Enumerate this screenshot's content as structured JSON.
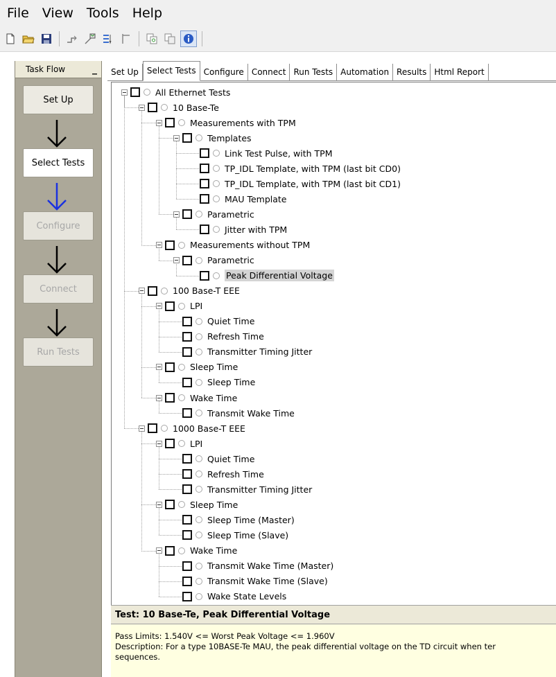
{
  "menu": [
    "File",
    "View",
    "Tools",
    "Help"
  ],
  "toolbar_icons": [
    "new-file-icon",
    "open-folder-icon",
    "save-icon",
    "step-icon",
    "export-icon",
    "filter-icon",
    "align-icon",
    "copy-icon",
    "paste-icon",
    "info-icon"
  ],
  "taskflow": {
    "header": "Task Flow",
    "minimize": "_",
    "steps": [
      {
        "label": "Set Up",
        "state": "done"
      },
      {
        "label": "Select Tests",
        "state": "active"
      },
      {
        "label": "Configure",
        "state": "disabled"
      },
      {
        "label": "Connect",
        "state": "disabled"
      },
      {
        "label": "Run Tests",
        "state": "disabled"
      }
    ],
    "arrow_colors": [
      "#000000",
      "#1a32e0",
      "#000000",
      "#000000"
    ]
  },
  "tabs": [
    "Set Up",
    "Select Tests",
    "Configure",
    "Connect",
    "Run Tests",
    "Automation",
    "Results",
    "Html Report"
  ],
  "selected_tab": "Select Tests",
  "tree": [
    {
      "label": "All Ethernet Tests",
      "level": 0,
      "exp": true
    },
    {
      "label": "10 Base-Te",
      "level": 1,
      "exp": true
    },
    {
      "label": "Measurements with TPM",
      "level": 2,
      "exp": true
    },
    {
      "label": "Templates",
      "level": 3,
      "exp": true
    },
    {
      "label": "Link Test Pulse, with TPM",
      "level": 4,
      "exp": false
    },
    {
      "label": "TP_IDL Template, with TPM (last bit CD0)",
      "level": 4,
      "exp": false
    },
    {
      "label": "TP_IDL Template, with TPM (last bit CD1)",
      "level": 4,
      "exp": false
    },
    {
      "label": "MAU Template",
      "level": 4,
      "exp": false
    },
    {
      "label": "Parametric",
      "level": 3,
      "exp": true
    },
    {
      "label": "Jitter with TPM",
      "level": 4,
      "exp": false
    },
    {
      "label": "Measurements without TPM",
      "level": 2,
      "exp": true
    },
    {
      "label": "Parametric",
      "level": 3,
      "exp": true
    },
    {
      "label": "Peak Differential Voltage",
      "level": 4,
      "exp": false,
      "selected": true
    },
    {
      "label": "100 Base-T EEE",
      "level": 1,
      "exp": true
    },
    {
      "label": "LPI",
      "level": 2,
      "exp": true
    },
    {
      "label": "Quiet Time",
      "level": 3,
      "exp": false
    },
    {
      "label": "Refresh Time",
      "level": 3,
      "exp": false
    },
    {
      "label": "Transmitter Timing Jitter",
      "level": 3,
      "exp": false
    },
    {
      "label": "Sleep Time",
      "level": 2,
      "exp": true
    },
    {
      "label": "Sleep Time",
      "level": 3,
      "exp": false
    },
    {
      "label": "Wake Time",
      "level": 2,
      "exp": true
    },
    {
      "label": "Transmit Wake Time",
      "level": 3,
      "exp": false
    },
    {
      "label": "1000 Base-T EEE",
      "level": 1,
      "exp": true
    },
    {
      "label": "LPI",
      "level": 2,
      "exp": true
    },
    {
      "label": "Quiet Time",
      "level": 3,
      "exp": false
    },
    {
      "label": "Refresh Time",
      "level": 3,
      "exp": false
    },
    {
      "label": "Transmitter Timing Jitter",
      "level": 3,
      "exp": false
    },
    {
      "label": "Sleep Time",
      "level": 2,
      "exp": true
    },
    {
      "label": "Sleep Time (Master)",
      "level": 3,
      "exp": false
    },
    {
      "label": "Sleep Time (Slave)",
      "level": 3,
      "exp": false
    },
    {
      "label": "Wake Time",
      "level": 2,
      "exp": true
    },
    {
      "label": "Transmit Wake Time (Master)",
      "level": 3,
      "exp": false
    },
    {
      "label": "Transmit Wake Time (Slave)",
      "level": 3,
      "exp": false
    },
    {
      "label": "Wake State Levels",
      "level": 3,
      "exp": false
    }
  ],
  "detail": {
    "title": "Test: 10 Base-Te, Peak Differential Voltage",
    "pass_limits": "Pass Limits: 1.540V <= Worst Peak Voltage <= 1.960V",
    "description_line1": "Description: For a type 10BASE-Te MAU, the peak differential voltage on the TD circuit when ter",
    "description_line2": "sequences."
  }
}
